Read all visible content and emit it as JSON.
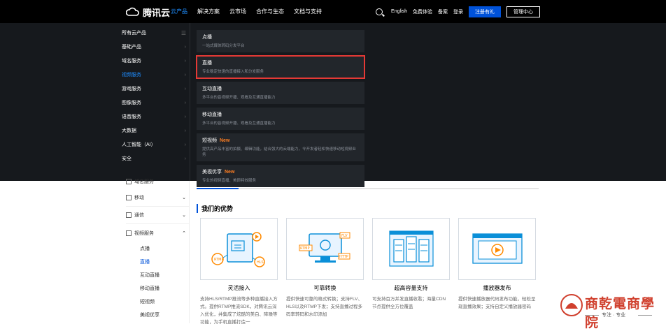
{
  "nav": {
    "brand": "腾讯云",
    "items": [
      "云产品",
      "解决方案",
      "云市场",
      "合作与生态",
      "文档与支持"
    ],
    "right": {
      "lang": "English",
      "free": "免费体验",
      "filing": "备案",
      "login": "登录",
      "register": "注册有礼",
      "console": "管理中心"
    }
  },
  "menu": {
    "categories": [
      "所有云产品",
      "基础产品",
      "域名服务",
      "视频服务",
      "游戏服务",
      "图像服务",
      "语音服务",
      "大数据",
      "人工智能（AI）",
      "安全"
    ],
    "active_category": "视频服务",
    "subs": [
      {
        "title": "点播",
        "desc": "一站式媒体转码分发平台",
        "new": ""
      },
      {
        "title": "直播",
        "desc": "专业稳定快速的直播接入和分发服务",
        "new": ""
      },
      {
        "title": "互动直播",
        "desc": "多平台的音视频开播、观看及互通直播能力",
        "new": ""
      },
      {
        "title": "移动直播",
        "desc": "多平台的音视频开播、观看及互通直播能力",
        "new": ""
      },
      {
        "title": "短视频",
        "desc": "提供高产品丰富的拍摄、编辑功能，结合强大的云端能力，令开发者轻松快速移动短视频业务",
        "new": "New"
      },
      {
        "title": "美视优享",
        "desc": "专业的视频直播、美颜特效服务",
        "new": "New"
      }
    ]
  },
  "sidebar": {
    "cut_item": "域名服务",
    "items": [
      {
        "label": "移动"
      },
      {
        "label": "通信"
      },
      {
        "label": "视频服务"
      }
    ],
    "video_subs": [
      "点播",
      "直播",
      "互动直播",
      "移动直播",
      "短视频",
      "美视优享"
    ],
    "active_sub": "直播"
  },
  "main": {
    "section_title": "我们的优势",
    "features": [
      {
        "title": "灵活接入",
        "desc": "支持HLS/RTMP推流等多种直播接入方式。提供RTMP推流SDK，对腾讯云深入优化，并集成了炫酷的美白、降噪等功能，为手机直播打造一"
      },
      {
        "title": "可靠转换",
        "desc": "提供快速可靠的格式转换；支持FLV、HLS以及RTMP下发；支持直播过程多码率转码和水印添加"
      },
      {
        "title": "超高容量支持",
        "desc": "可支持百万并发直播收看；海量CDN节点提供全方位覆盖"
      },
      {
        "title": "播放器发布",
        "desc": "提供快速播放器代码发布功能，轻松呈现直播效果；支持自定义播放器密码"
      }
    ]
  },
  "watermark": {
    "text": "商乾電商學院",
    "sub": "专注 · 专业"
  },
  "colors": {
    "accent": "#0052d9",
    "highlight": "#e53935",
    "dark": "#16191d"
  }
}
